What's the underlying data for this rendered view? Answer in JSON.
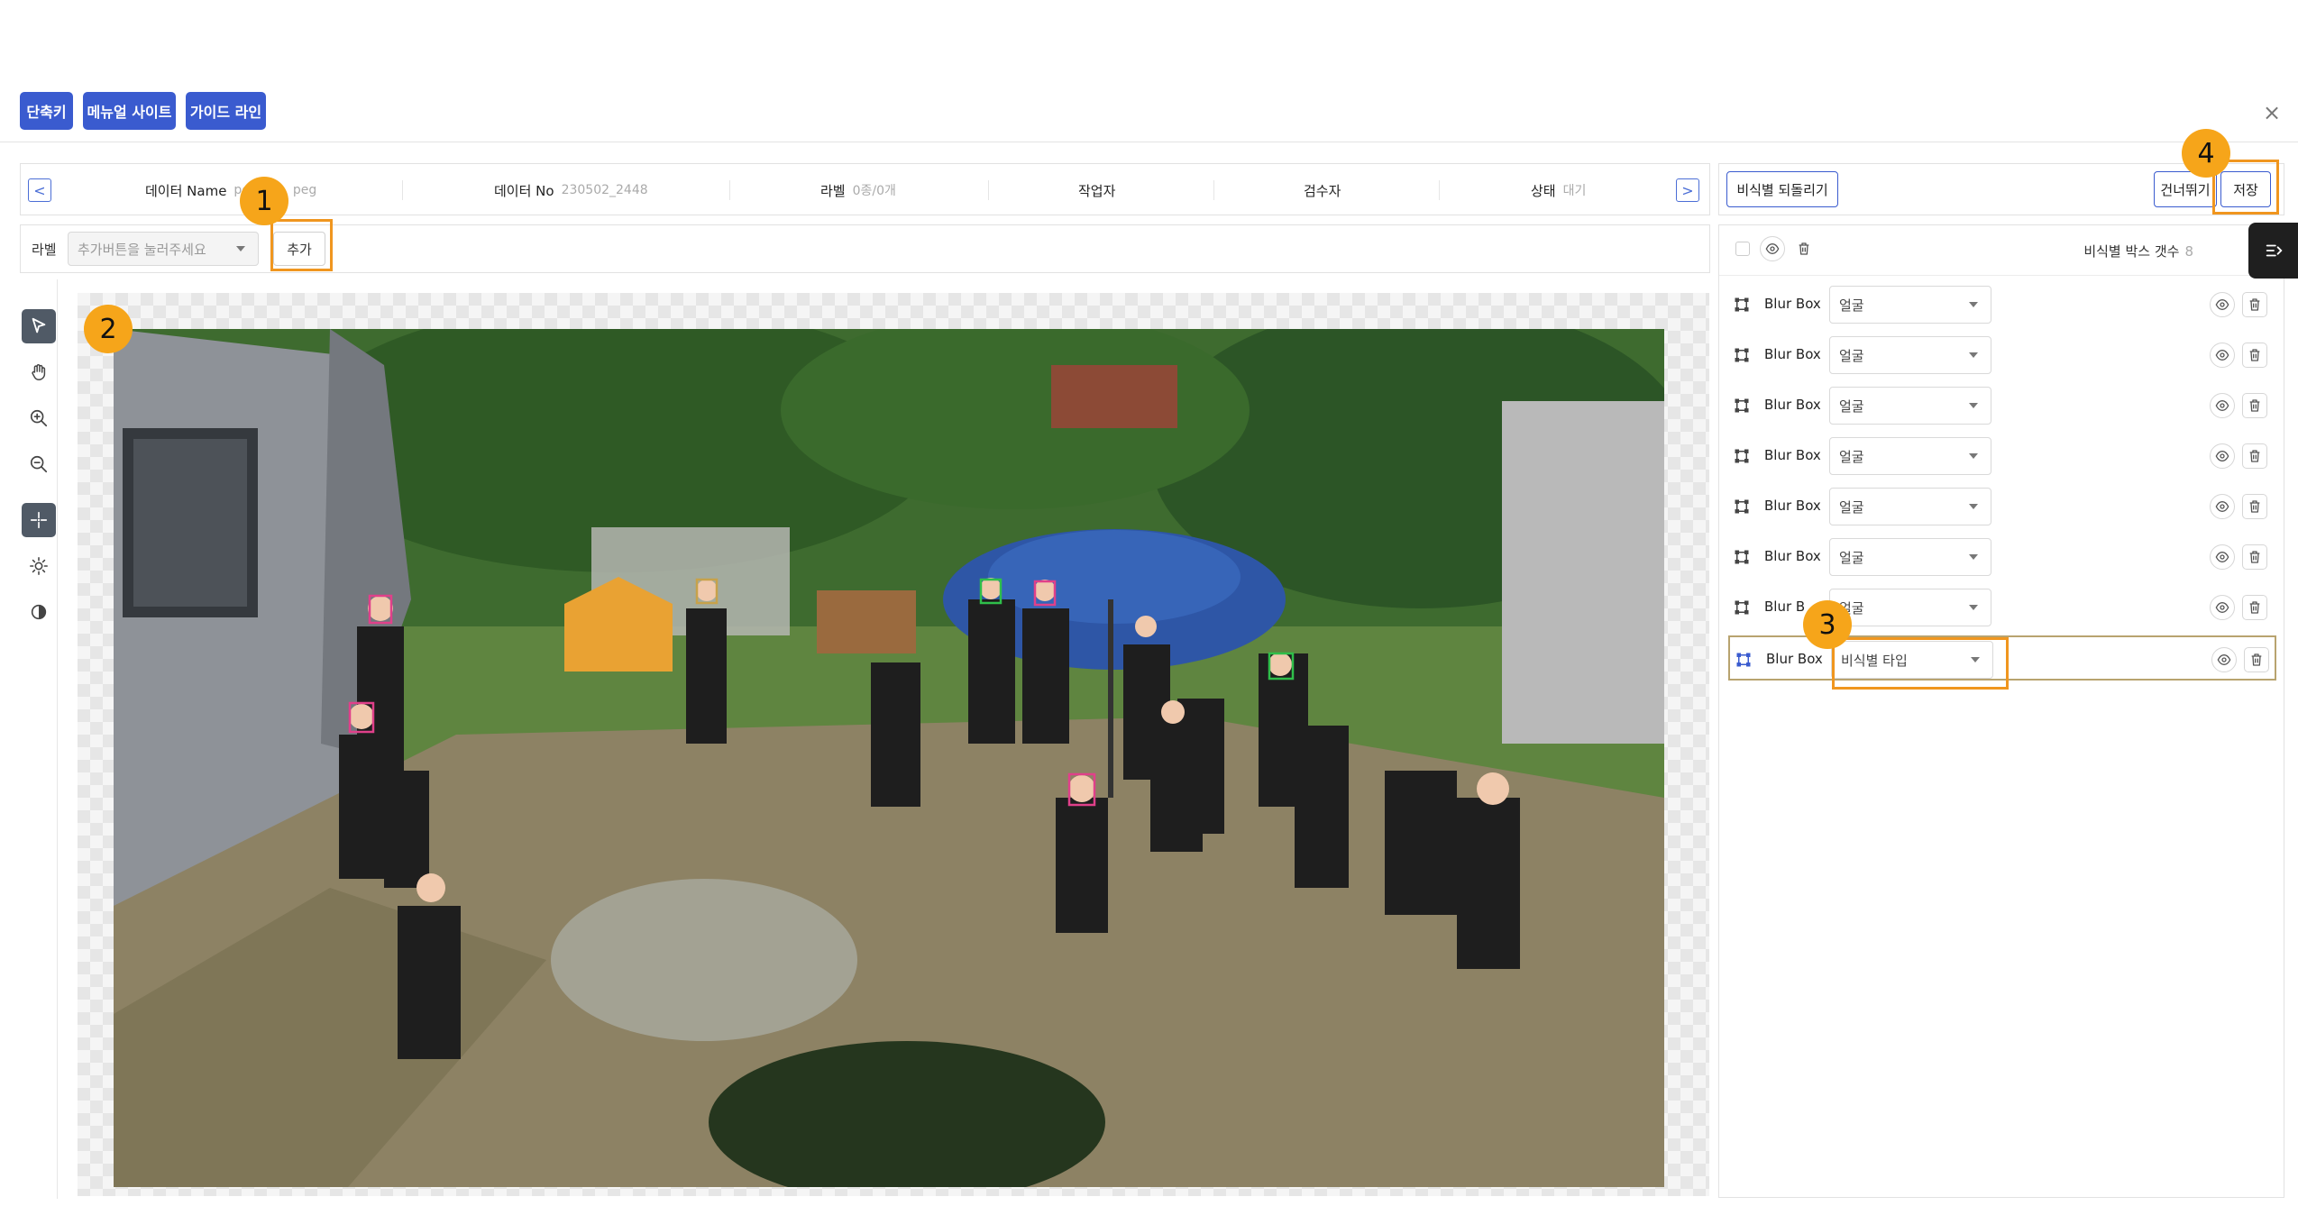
{
  "top_buttons": {
    "shortcut": "단축키",
    "manual": "메뉴얼 사이트",
    "guide": "가이드 라인"
  },
  "close_glyph": "×",
  "info_bar": {
    "prev_glyph": "<",
    "next_glyph": ">",
    "data_name_label": "데이터 Name",
    "data_name_value": "pe",
    "data_name_value_tail": "peg",
    "data_no_label": "데이터 No",
    "data_no_value": "230502_2448",
    "label_label": "라벨",
    "label_value": "0종/0개",
    "worker_label": "작업자",
    "reviewer_label": "검수자",
    "status_label": "상태",
    "status_value": "대기"
  },
  "label_bar": {
    "label": "라벨",
    "select_placeholder": "추가버튼을 눌러주세요",
    "add_button": "추가"
  },
  "right_top": {
    "restore": "비식별 되돌리기",
    "skip": "건너뛰기",
    "save": "저장"
  },
  "right_panel": {
    "count_label": "비식별 박스 갯수",
    "count_value": "8",
    "rows": [
      {
        "name": "Blur Box",
        "type": "얼굴"
      },
      {
        "name": "Blur Box",
        "type": "얼굴"
      },
      {
        "name": "Blur Box",
        "type": "얼굴"
      },
      {
        "name": "Blur Box",
        "type": "얼굴"
      },
      {
        "name": "Blur Box",
        "type": "얼굴"
      },
      {
        "name": "Blur Box",
        "type": "얼굴"
      },
      {
        "name": "Blur B",
        "type": "얼굴"
      },
      {
        "name": "Blur Box",
        "type": "비식별 타입"
      }
    ]
  },
  "callouts": [
    "1",
    "2",
    "3",
    "4"
  ],
  "colors": {
    "primary": "#3a5bcf",
    "callout": "#f6a51a",
    "highlight": "#f0961f",
    "face_box_pink": "#e0408a",
    "face_box_green": "#2fbf4a"
  },
  "icons": [
    "pointer-icon",
    "hand-icon",
    "zoom-in-icon",
    "zoom-out-icon",
    "crosshair-icon",
    "brightness-icon",
    "contrast-icon",
    "eye-icon",
    "trash-icon",
    "bounding-box-icon",
    "panel-toggle-icon"
  ]
}
